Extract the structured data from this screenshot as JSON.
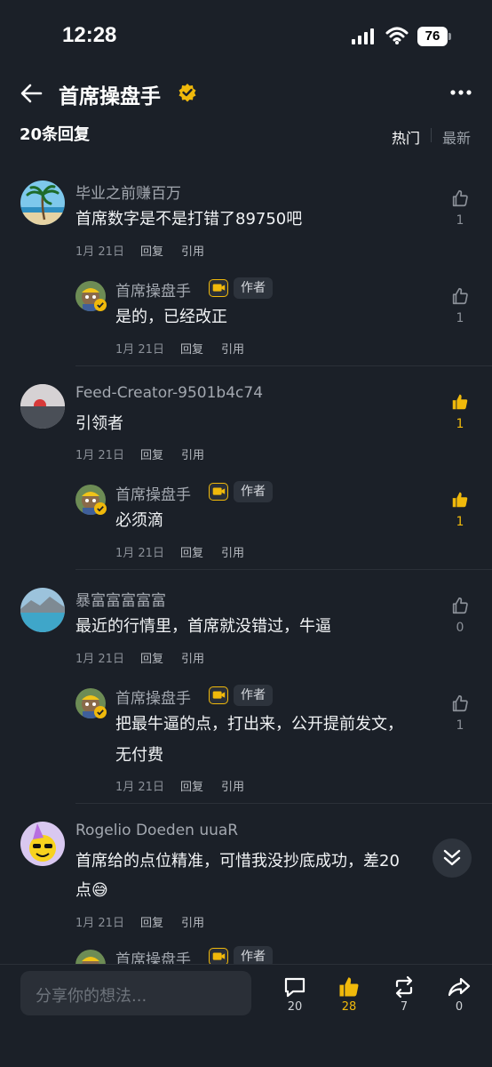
{
  "status": {
    "time": "12:28",
    "battery": "76"
  },
  "header": {
    "title": "首席操盘手"
  },
  "replies": {
    "count_label": "20条回复",
    "sort_hot": "热门",
    "sort_new": "最新"
  },
  "labels": {
    "reply": "回复",
    "quote": "引用",
    "author": "作者"
  },
  "comments": [
    {
      "user": "毕业之前赚百万",
      "text": "首席数字是不是打错了89750吧",
      "date": "1月 21日",
      "likes": "1",
      "liked": false,
      "reply": {
        "user": "首席操盘手",
        "text": "是的，已经改正",
        "date": "1月 21日",
        "likes": "1",
        "liked": false
      }
    },
    {
      "user": "Feed-Creator-9501b4c74",
      "text": "引领者",
      "date": "1月 21日",
      "likes": "1",
      "liked": true,
      "reply": {
        "user": "首席操盘手",
        "text": "必须滴",
        "date": "1月 21日",
        "likes": "1",
        "liked": true
      }
    },
    {
      "user": "暴富富富富富",
      "text": "最近的行情里，首席就没错过，牛逼",
      "date": "1月 21日",
      "likes": "0",
      "liked": false,
      "reply": {
        "user": "首席操盘手",
        "text_line1": "把最牛逼的点，打出来，公开提前发文，",
        "text_line2": "无付费",
        "date": "1月 21日",
        "likes": "1",
        "liked": false
      }
    },
    {
      "user": "Rogelio Doeden uuaR",
      "text_line1": "首席给的点位精准，可惜我没抄底成功，差20",
      "text_line2": "点😅",
      "date": "1月 21日",
      "reply": {
        "user": "首席操盘手"
      }
    }
  ],
  "bottom": {
    "placeholder": "分享你的想法...",
    "comments": "20",
    "likes": "28",
    "reposts": "7",
    "shares": "0"
  },
  "colors": {
    "accent": "#f0b90b",
    "background": "#1b2028"
  }
}
